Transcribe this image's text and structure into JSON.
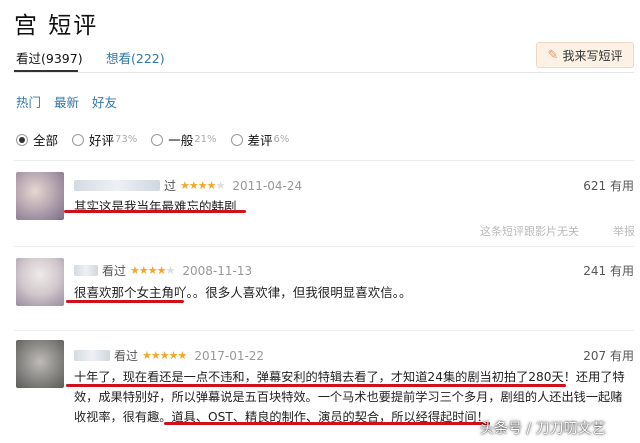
{
  "page": {
    "title": "宫 短评"
  },
  "tabs": [
    {
      "label": "看过(9397)"
    },
    {
      "label": "想看(222)"
    }
  ],
  "write_button": {
    "label": "我来写短评",
    "icon": "pencil-icon"
  },
  "sort_options": [
    "热门",
    "最新",
    "好友"
  ],
  "filters": [
    {
      "label": "全部",
      "pct": "",
      "checked": true
    },
    {
      "label": "好评",
      "pct": "73%",
      "checked": false
    },
    {
      "label": "一般",
      "pct": "21%",
      "checked": false
    },
    {
      "label": "差评",
      "pct": "6%",
      "checked": false
    }
  ],
  "comments": [
    {
      "status": "过",
      "rating": 4,
      "date": "2011-04-24",
      "useful": "621 有用",
      "lines": [
        "其实这是我当年最难忘的韩剧"
      ]
    },
    {
      "status": "看过",
      "rating": 4,
      "date": "2008-11-13",
      "useful": "241 有用",
      "lines": [
        "很喜欢那个女主角吖。。很多人喜欢律，但我很明显喜欢信。。"
      ]
    },
    {
      "status": "看过",
      "rating": 5,
      "date": "2017-01-22",
      "useful": "207 有用",
      "lines": [
        "十年了，现在看还是一点不违和，弹幕安利的特辑去看了，才知道24集的剧当初拍了280天！还用了特",
        "效，成果特别好，所以弹幕说是五百块特效。一个马术也要提前学习三个多月，剧组的人还出钱一起赌",
        "收视率，很有趣。道具、OST、精良的制作、演员的契合，所以经得起时间！"
      ]
    }
  ],
  "spoiler_note": "这条短评跟影片无关",
  "report_label": "举报",
  "watermark": "头条号 / 刀刀叨文艺",
  "colors": {
    "link": "#3377aa",
    "star": "#f5a623",
    "underline": "#d0111b"
  }
}
